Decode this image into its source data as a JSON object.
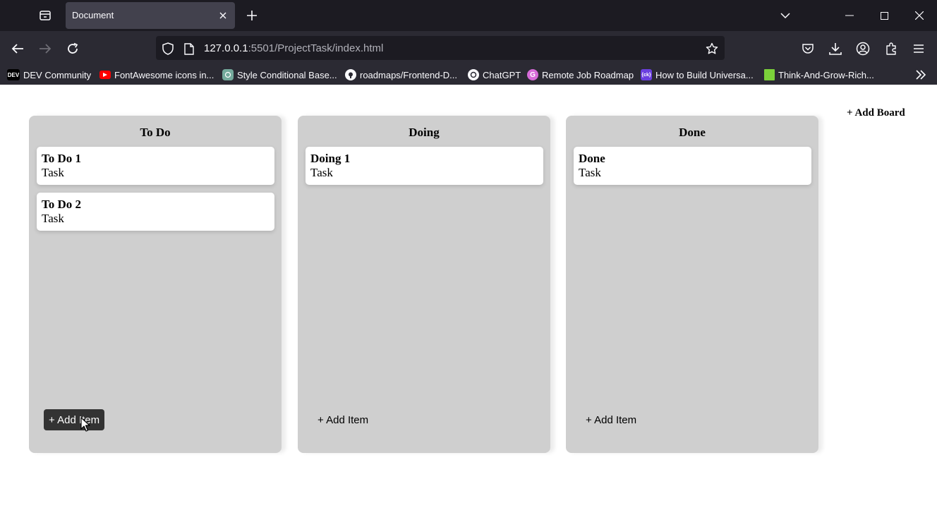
{
  "browser": {
    "tab_title": "Document",
    "url_host": "127.0.0.1",
    "url_rest": ":5501/ProjectTask/index.html",
    "bookmarks": [
      {
        "label": "DEV Community",
        "icon": "dev-icon",
        "color": "#000000"
      },
      {
        "label": "FontAwesome icons in...",
        "icon": "youtube-icon",
        "color": "#ff0000"
      },
      {
        "label": "Style Conditional Base...",
        "icon": "openai-icon",
        "color": "#74aa9c"
      },
      {
        "label": "roadmaps/Frontend-D...",
        "icon": "github-icon",
        "color": "#ffffff"
      },
      {
        "label": "ChatGPT",
        "icon": "chatgpt-icon",
        "color": "#ffffff"
      },
      {
        "label": "Remote Job Roadmap",
        "icon": "g-icon",
        "color": "#d66bd8"
      },
      {
        "label": "How to Build Universa...",
        "icon": "ck-icon",
        "color": "#6b3fe0"
      },
      {
        "label": "Think-And-Grow-Rich...",
        "icon": "book-icon",
        "color": "#7bd13a"
      }
    ]
  },
  "page": {
    "add_board_label": "+ Add Board",
    "boards": [
      {
        "title": "To Do",
        "cards": [
          {
            "title": "To Do 1",
            "desc": "Task"
          },
          {
            "title": "To Do 2",
            "desc": "Task"
          }
        ],
        "add_item_label": "+ Add Item"
      },
      {
        "title": "Doing",
        "cards": [
          {
            "title": "Doing 1",
            "desc": "Task"
          }
        ],
        "add_item_label": "+ Add Item"
      },
      {
        "title": "Done",
        "cards": [
          {
            "title": "Done",
            "desc": "Task"
          }
        ],
        "add_item_label": "+ Add Item"
      }
    ]
  },
  "colors": {
    "board_bg": "#cfcfcf",
    "card_bg": "#ffffff",
    "add_item_hover_bg": "#333333"
  }
}
